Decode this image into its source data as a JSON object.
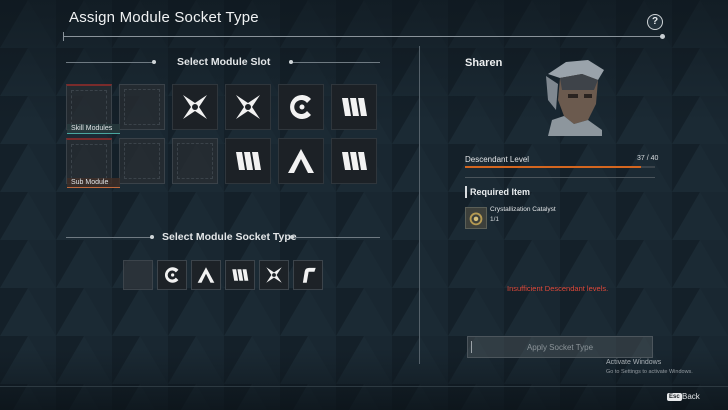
{
  "header": {
    "title": "Assign Module Socket Type",
    "help_label": "?"
  },
  "module_slot": {
    "heading": "Select Module Slot",
    "skill_tag": "Skill Modules",
    "sub_tag": "Sub Module",
    "row1": [
      "empty",
      "empty",
      "xenon",
      "xenon",
      "cerulean",
      "malachite"
    ],
    "row2": [
      "empty",
      "empty",
      "empty",
      "malachite",
      "almandine",
      "malachite"
    ]
  },
  "socket_type": {
    "heading": "Select Module Socket Type",
    "options": [
      "empty",
      "cerulean",
      "almandine",
      "malachite",
      "xenon",
      "rutile"
    ]
  },
  "character": {
    "name": "Sharen",
    "level_label": "Descendant Level",
    "level_value": "37 / 40",
    "level_progress": 0.925
  },
  "required": {
    "label": "Required Item",
    "item_name": "Crystallization Catalyst",
    "item_qty": "1/1"
  },
  "warning": "Insufficient Descendant levels.",
  "apply_label": "Apply Socket Type",
  "watermark": {
    "line1": "Activate Windows",
    "line2": "Go to Settings to activate Windows."
  },
  "footer": {
    "esc_key": "Esc",
    "back_label": "Back"
  },
  "colors": {
    "accent_orange": "#d4661f",
    "warning_red": "#e0493a",
    "skill_tag": "#4aa7a0",
    "sub_tag": "#c0693c"
  }
}
